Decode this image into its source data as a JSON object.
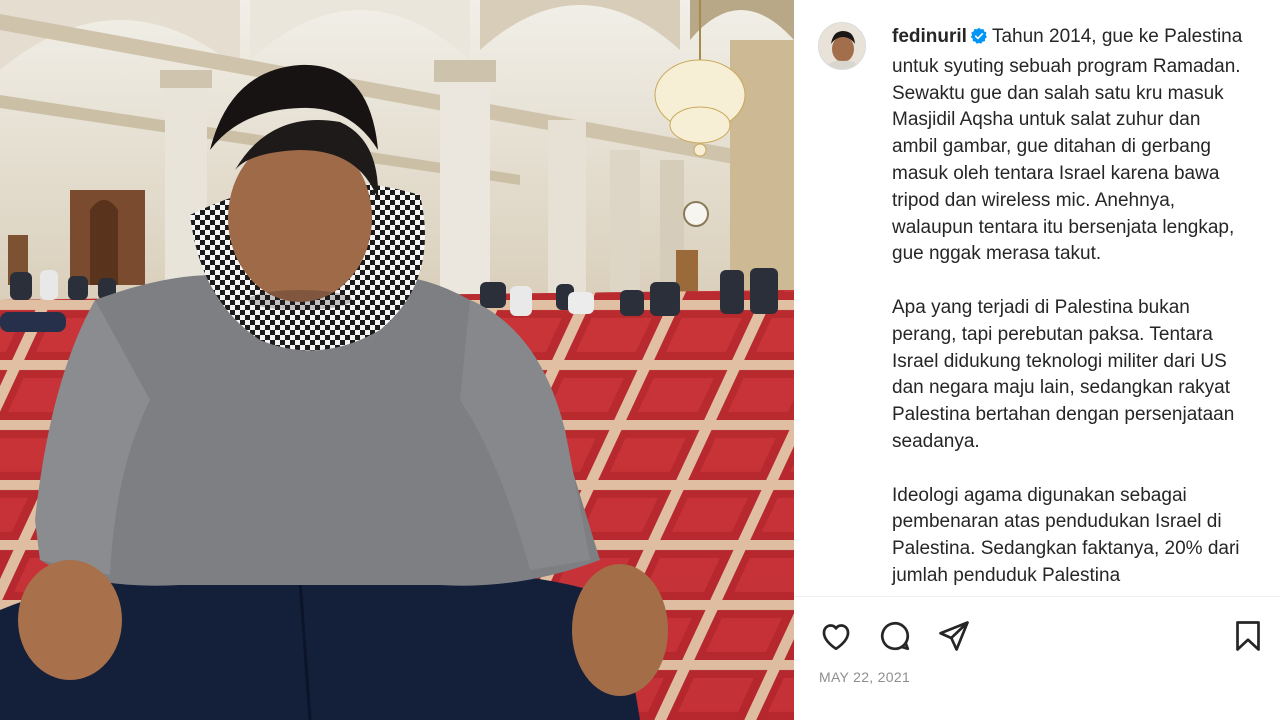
{
  "post": {
    "username": "fedinuril",
    "verified": true,
    "caption_p1": "Tahun 2014, gue ke Palestina untuk syuting sebuah program Ramadan. Sewaktu gue dan salah satu kru masuk Masjidil Aqsha untuk salat zuhur dan ambil gambar, gue ditahan di gerbang masuk oleh tentara Israel karena bawa tripod dan wireless mic. Anehnya, walaupun tentara itu bersenjata lengkap, gue nggak merasa takut.",
    "caption_p2": "Apa yang terjadi di Palestina bukan perang, tapi perebutan paksa. Tentara Israel didukung teknologi militer dari US dan negara maju lain, sedangkan rakyat Palestina bertahan dengan persenjataan seadanya.",
    "caption_p3": "Ideologi agama digunakan sebagai pembenaran atas pendudukan Israel di Palestina. Sedangkan faktanya, 20% dari jumlah penduduk Palestina",
    "date": "MAY 22, 2021"
  },
  "icons": {
    "like": "heart-icon",
    "comment": "comment-icon",
    "share": "share-icon",
    "save": "bookmark-icon",
    "verified": "verified-badge-icon"
  },
  "colors": {
    "verified_blue": "#0095f6",
    "text": "#262626",
    "muted": "#8e8e8e",
    "carpet_red": "#b92a2f"
  }
}
